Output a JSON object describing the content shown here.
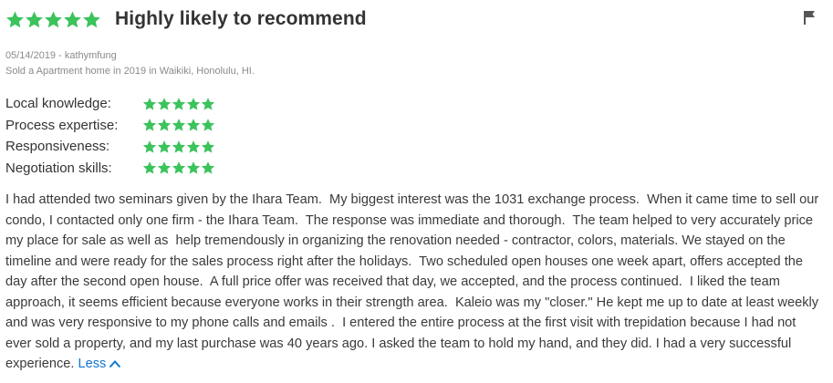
{
  "review": {
    "overall_stars": 5,
    "title": "Highly likely to recommend",
    "date_author": "05/14/2019 - kathymfung",
    "transaction": "Sold a Apartment home in 2019 in Waikiki, Honolulu, HI.",
    "body": "I had attended two seminars given by the Ihara Team.  My biggest interest was the 1031 exchange process.  When it came time to sell our condo, I contacted only one firm - the Ihara Team.  The response was immediate and thorough.  The team helped to very accurately price my place for sale as well as  help tremendously in organizing the renovation needed - contractor, colors, materials. We stayed on the timeline and were ready for the sales process right after the holidays.  Two scheduled open houses one week apart, offers accepted the day after the second open house.  A full price offer was received that day, we accepted, and the process continued.  I liked the team approach, it seems efficient because everyone works in their strength area.  Kaleio was my \"closer.\" He kept me up to date at least weekly and was very responsive to my phone calls and emails .  I entered the entire process at the first visit with trepidation because I had not ever sold a property, and my last purchase was 40 years ago. I asked the team to hold my hand, and they did. I had a very successful experience. ",
    "less_label": "Less"
  },
  "ratings": [
    {
      "label": "Local knowledge:",
      "stars": 5
    },
    {
      "label": "Process expertise:",
      "stars": 5
    },
    {
      "label": "Responsiveness:",
      "stars": 5
    },
    {
      "label": "Negotiation skills:",
      "stars": 5
    }
  ],
  "icons": {
    "star": "star-icon",
    "flag": "flag-icon",
    "less": "chevron-up-icon"
  },
  "colors": {
    "star": "#3bc35c",
    "link": "#1276cf",
    "title": "#333333",
    "meta": "#8a8a8a",
    "flag": "#555555"
  }
}
